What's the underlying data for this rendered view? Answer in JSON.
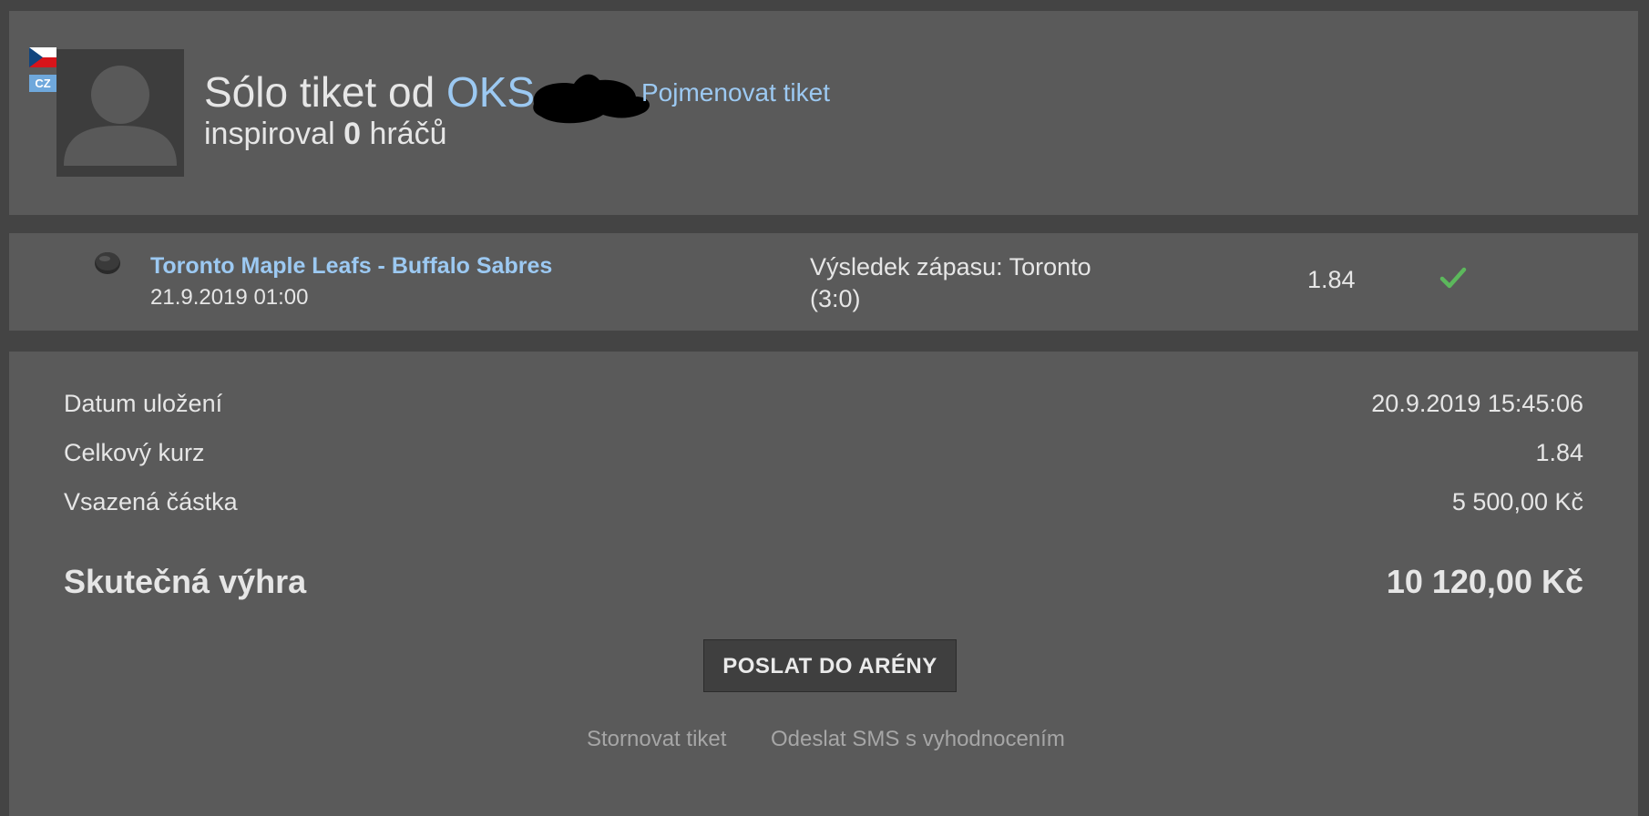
{
  "header": {
    "flag_icon": "czech-flag-icon",
    "language_badge": "CZ",
    "avatar_icon": "user-silhouette-icon",
    "title_prefix": "Sólo tiket od",
    "username": "OKS",
    "rename_link": "Pojmenovat tiket",
    "inspired_prefix": "inspiroval",
    "inspired_count": "0",
    "inspired_suffix": "hráčů"
  },
  "match": {
    "icon": "hockey-puck-icon",
    "title": "Toronto Maple Leafs - Buffalo Sabres",
    "date": "21.9.2019 01:00",
    "result": "Výsledek zápasu: Toronto (3:0)",
    "odds": "1.84",
    "status_icon": "check-icon",
    "status_color": "#5cb85c"
  },
  "summary": {
    "rows": [
      {
        "label": "Datum uložení",
        "value": "20.9.2019 15:45:06"
      },
      {
        "label": "Celkový kurz",
        "value": "1.84"
      },
      {
        "label": "Vsazená částka",
        "value": "5 500,00 Kč"
      }
    ],
    "win_label": "Skutečná výhra",
    "win_value": "10 120,00 Kč",
    "send_button": "POSLAT DO ARÉNY",
    "cancel_link": "Stornovat tiket",
    "sms_link": "Odeslat SMS s vyhodnocením"
  },
  "colors": {
    "background": "#444444",
    "panel": "#5a5a5a",
    "link": "#9cc9f2",
    "text": "#e6e6e6"
  }
}
